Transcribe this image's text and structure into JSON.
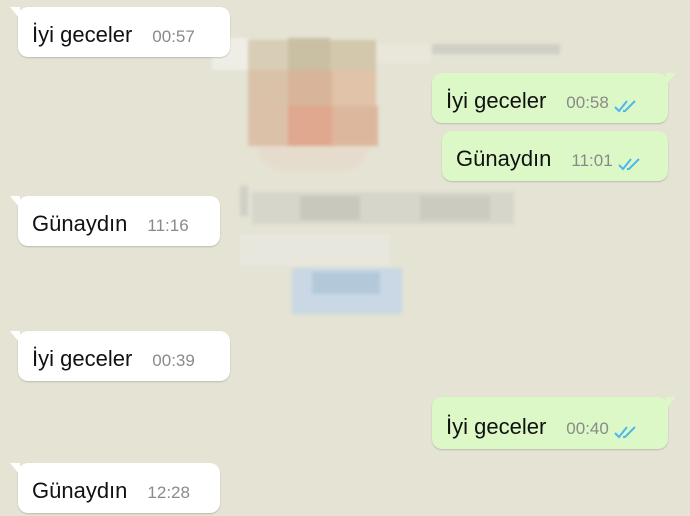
{
  "messages": [
    {
      "direction": "in",
      "text": "İyi geceler",
      "time": "00:57",
      "read": false
    },
    {
      "direction": "out",
      "text": "İyi geceler",
      "time": "00:58",
      "read": true
    },
    {
      "direction": "out",
      "text": "Günaydın",
      "time": "11:01",
      "read": true
    },
    {
      "direction": "in",
      "text": "Günaydın",
      "time": "11:16",
      "read": false
    },
    {
      "direction": "in",
      "text": "İyi geceler",
      "time": "00:39",
      "read": false
    },
    {
      "direction": "out",
      "text": "İyi geceler",
      "time": "00:40",
      "read": true
    },
    {
      "direction": "in",
      "text": "Günaydın",
      "time": "12:28",
      "read": false
    }
  ],
  "colors": {
    "background": "#e4e3d4",
    "incoming_bubble": "#ffffff",
    "outgoing_bubble": "#dcf8c6",
    "read_ticks": "#4fb6ec",
    "timestamp": "#8a8a8a"
  },
  "icons": {
    "read_receipt": "double-check-icon"
  }
}
